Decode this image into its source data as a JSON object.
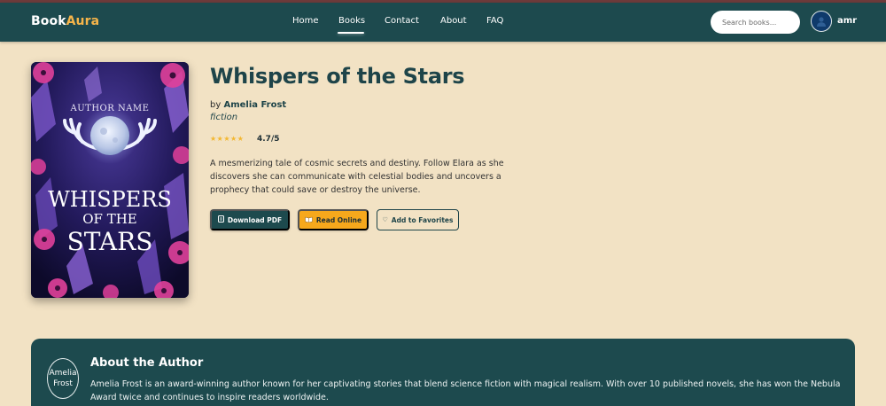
{
  "brand": {
    "name_part1": "Book",
    "name_part2": "Aura"
  },
  "nav": {
    "items": [
      {
        "label": "Home"
      },
      {
        "label": "Books"
      },
      {
        "label": "Contact"
      },
      {
        "label": "About"
      },
      {
        "label": "FAQ"
      }
    ],
    "active": "Books"
  },
  "search": {
    "placeholder": "Search books...",
    "value": ""
  },
  "user": {
    "name": "amr"
  },
  "book": {
    "cover": {
      "author_text": "AUTHOR NAME",
      "title_line1": "WHISPERS",
      "title_line2": "OF THE",
      "title_line3": "STARS"
    },
    "title": "Whispers of the Stars",
    "by_label": "by",
    "author": "Amelia Frost",
    "genre": "fiction",
    "stars": "★★★★★",
    "rating": "4.7/5",
    "description": "A mesmerizing tale of cosmic secrets and destiny. Follow Elara as she discovers she can communicate with celestial bodies and uncovers a prophecy that could save or destroy the universe."
  },
  "actions": {
    "download_label": "Download PDF",
    "read_label": "Read Online",
    "favorite_label": "Add to Favorites"
  },
  "about_author": {
    "heading": "About the Author",
    "photo_alt": "Amelia Frost",
    "bio": "Amelia Frost is an award-winning author known for her captivating stories that blend science fiction with magical realism. With over 10 published novels, she has won the Nebula Award twice and continues to inspire readers worldwide."
  },
  "colors": {
    "header_bg": "#1d4a4e",
    "page_bg": "#f2e2c4",
    "accent": "#f6a81c",
    "star": "#f3b730"
  }
}
